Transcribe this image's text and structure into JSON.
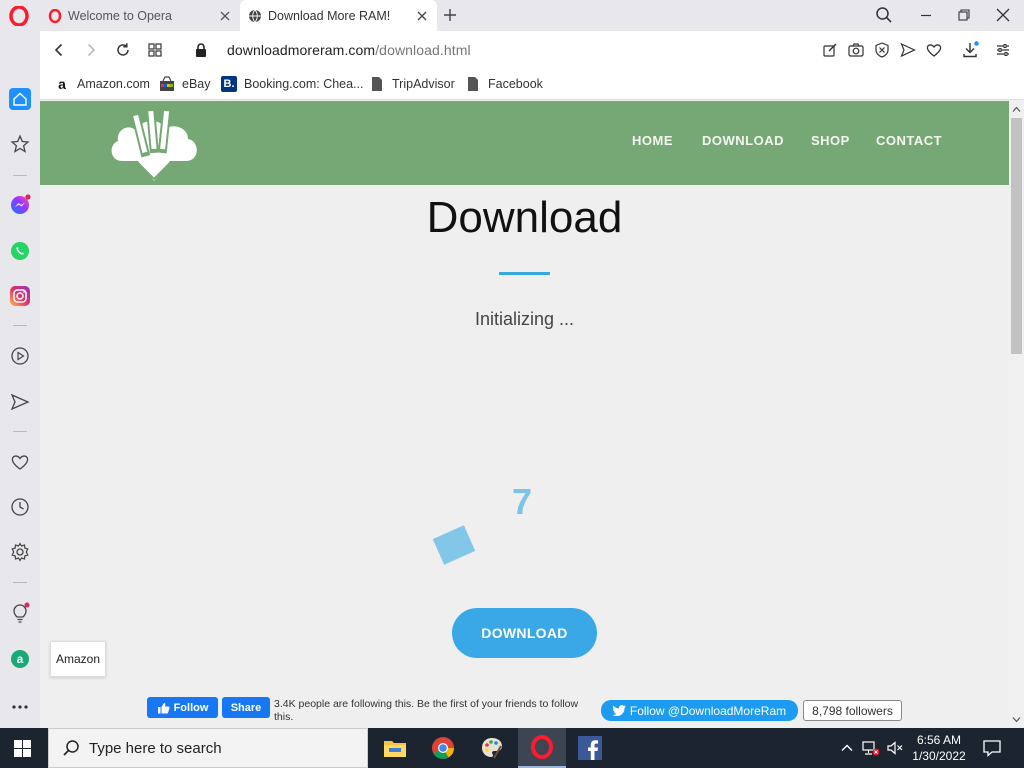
{
  "browser": {
    "tabs": [
      {
        "title": "Welcome to Opera",
        "active": false
      },
      {
        "title": "Download More RAM!",
        "active": true
      }
    ],
    "address": {
      "domain": "downloadmoreram.com",
      "path": "/download.html"
    },
    "bookmarks": [
      "Amazon.com",
      "eBay",
      "Booking.com: Chea...",
      "TripAdvisor",
      "Facebook"
    ],
    "sidebar_tooltip": "Amazon"
  },
  "site": {
    "nav": [
      "HOME",
      "DOWNLOAD",
      "SHOP",
      "CONTACT"
    ],
    "heading": "Download",
    "status": "Initializing ...",
    "counter": "7",
    "download_button": "DOWNLOAD",
    "social": {
      "fb_follow": "Follow",
      "fb_share": "Share",
      "fb_text": "3.4K people are following this. Be the first of your friends to follow this.",
      "tw_follow": "Follow @DownloadMoreRam",
      "tw_followers": "8,798 followers"
    }
  },
  "taskbar": {
    "search_placeholder": "Type here to search",
    "time": "6:56 AM",
    "date": "1/30/2022"
  },
  "colors": {
    "header_green": "#76a875",
    "accent_blue": "#3aa8e6",
    "counter_blue": "#7cc4e7",
    "opera_red": "#ff1b2d"
  }
}
